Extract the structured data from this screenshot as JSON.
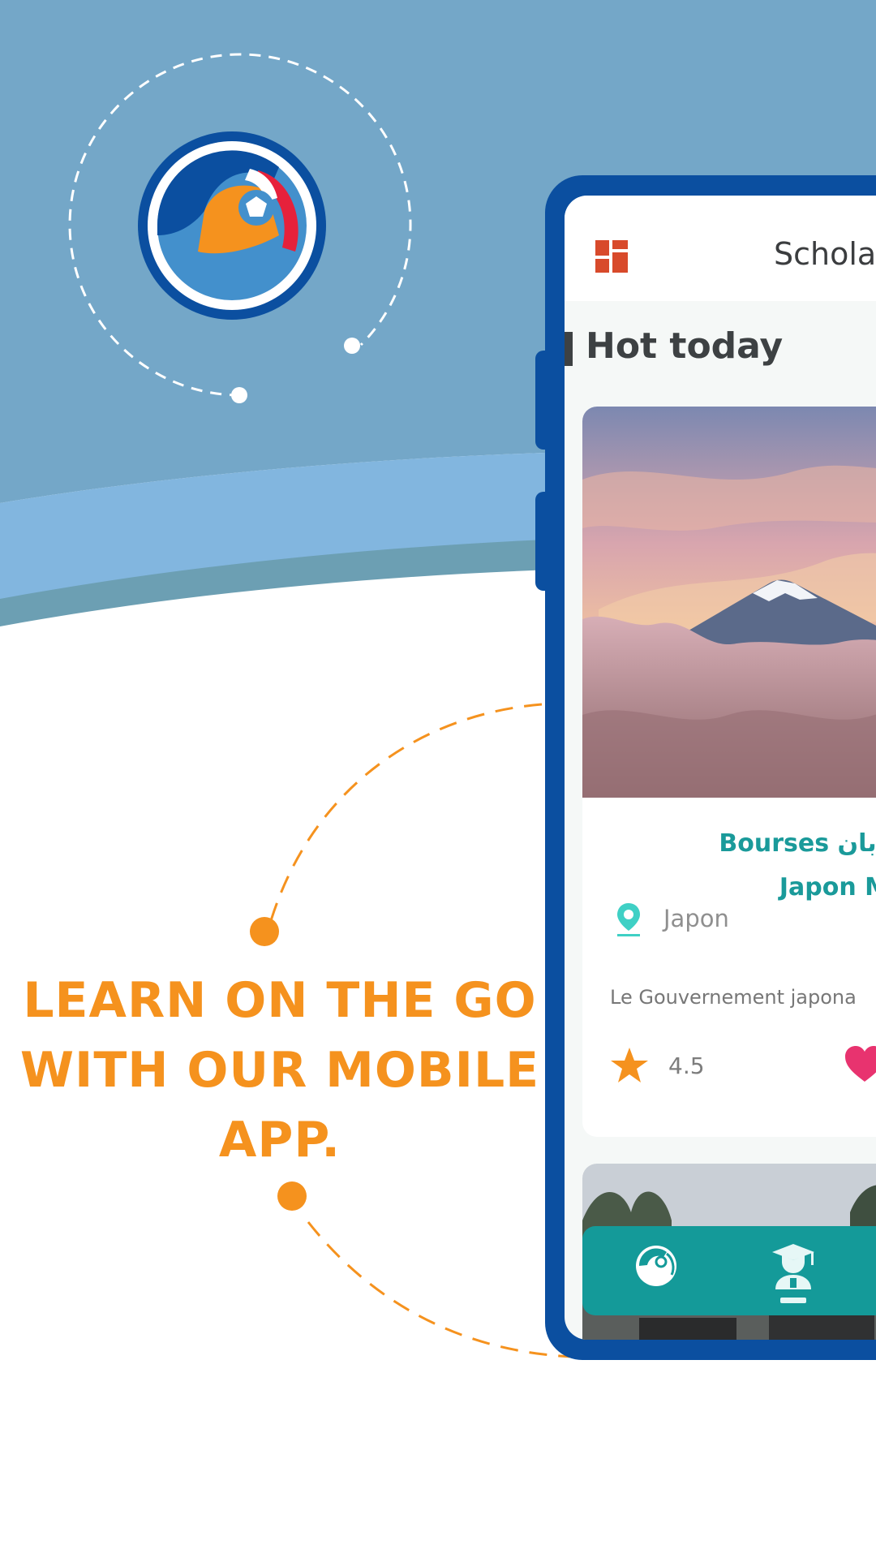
{
  "headline": {
    "line1": "LEARN ON THE GO",
    "line2": "WITH OUR MOBILE",
    "line3": "APP."
  },
  "colors": {
    "background_top": "#74a7c8",
    "wave_light": "#82b6df",
    "phone_frame": "#0b4fa0",
    "accent_orange": "#f5921e",
    "teal": "#149a99",
    "heart": "#e8336f"
  },
  "app": {
    "title": "Schola",
    "section_title": "Hot today",
    "menu_icon": "grid-icon"
  },
  "card": {
    "title_line1": "Bourses باليابان",
    "title_line2": "Japon Mon",
    "location": "Japon",
    "description": "Le Gouvernement japona",
    "rating": "4.5"
  },
  "nav": {
    "items": [
      "logo-icon",
      "graduate-icon"
    ]
  }
}
